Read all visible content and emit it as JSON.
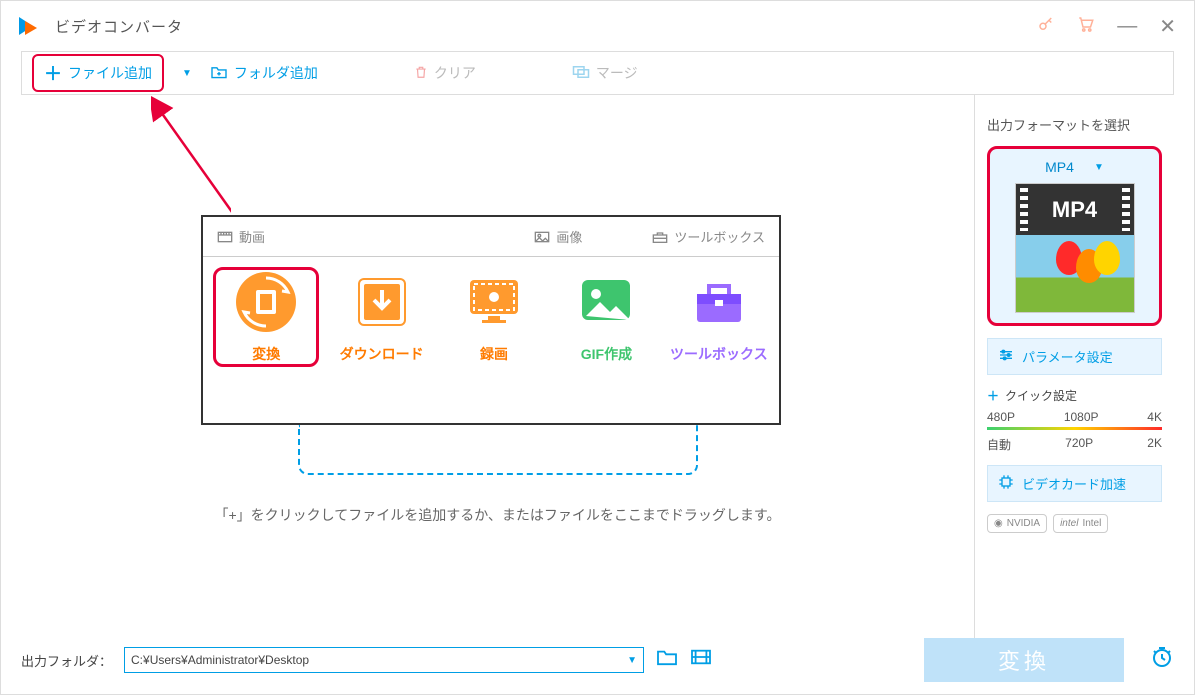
{
  "title": "ビデオコンバータ",
  "toolbar": {
    "add_file": "ファイル追加",
    "add_folder": "フォルダ追加",
    "clear": "クリア",
    "merge": "マージ"
  },
  "panel": {
    "tabs": {
      "video": "動画",
      "image": "画像",
      "toolbox": "ツールボックス"
    },
    "cards": {
      "convert": "変換",
      "download": "ダウンロード",
      "record": "録画",
      "gif": "GIF作成",
      "toolbox": "ツールボックス"
    }
  },
  "hint": "「+」をクリックしてファイルを追加するか、またはファイルをここまでドラッグします。",
  "sidebar": {
    "title": "出力フォーマットを選択",
    "format_label": "MP4",
    "format_thumb_text": "MP4",
    "param_btn": "パラメータ設定",
    "quick_title": "クイック設定",
    "res_top": {
      "p480": "480P",
      "p1080": "1080P",
      "k4": "4K"
    },
    "res_bot": {
      "auto": "自動",
      "p720": "720P",
      "k2": "2K"
    },
    "gpu_btn": "ビデオカード加速",
    "nvidia": "NVIDIA",
    "intel": "Intel"
  },
  "bottom": {
    "label": "出力フォルダ：",
    "path": "C:¥Users¥Administrator¥Desktop",
    "convert": "変換"
  }
}
